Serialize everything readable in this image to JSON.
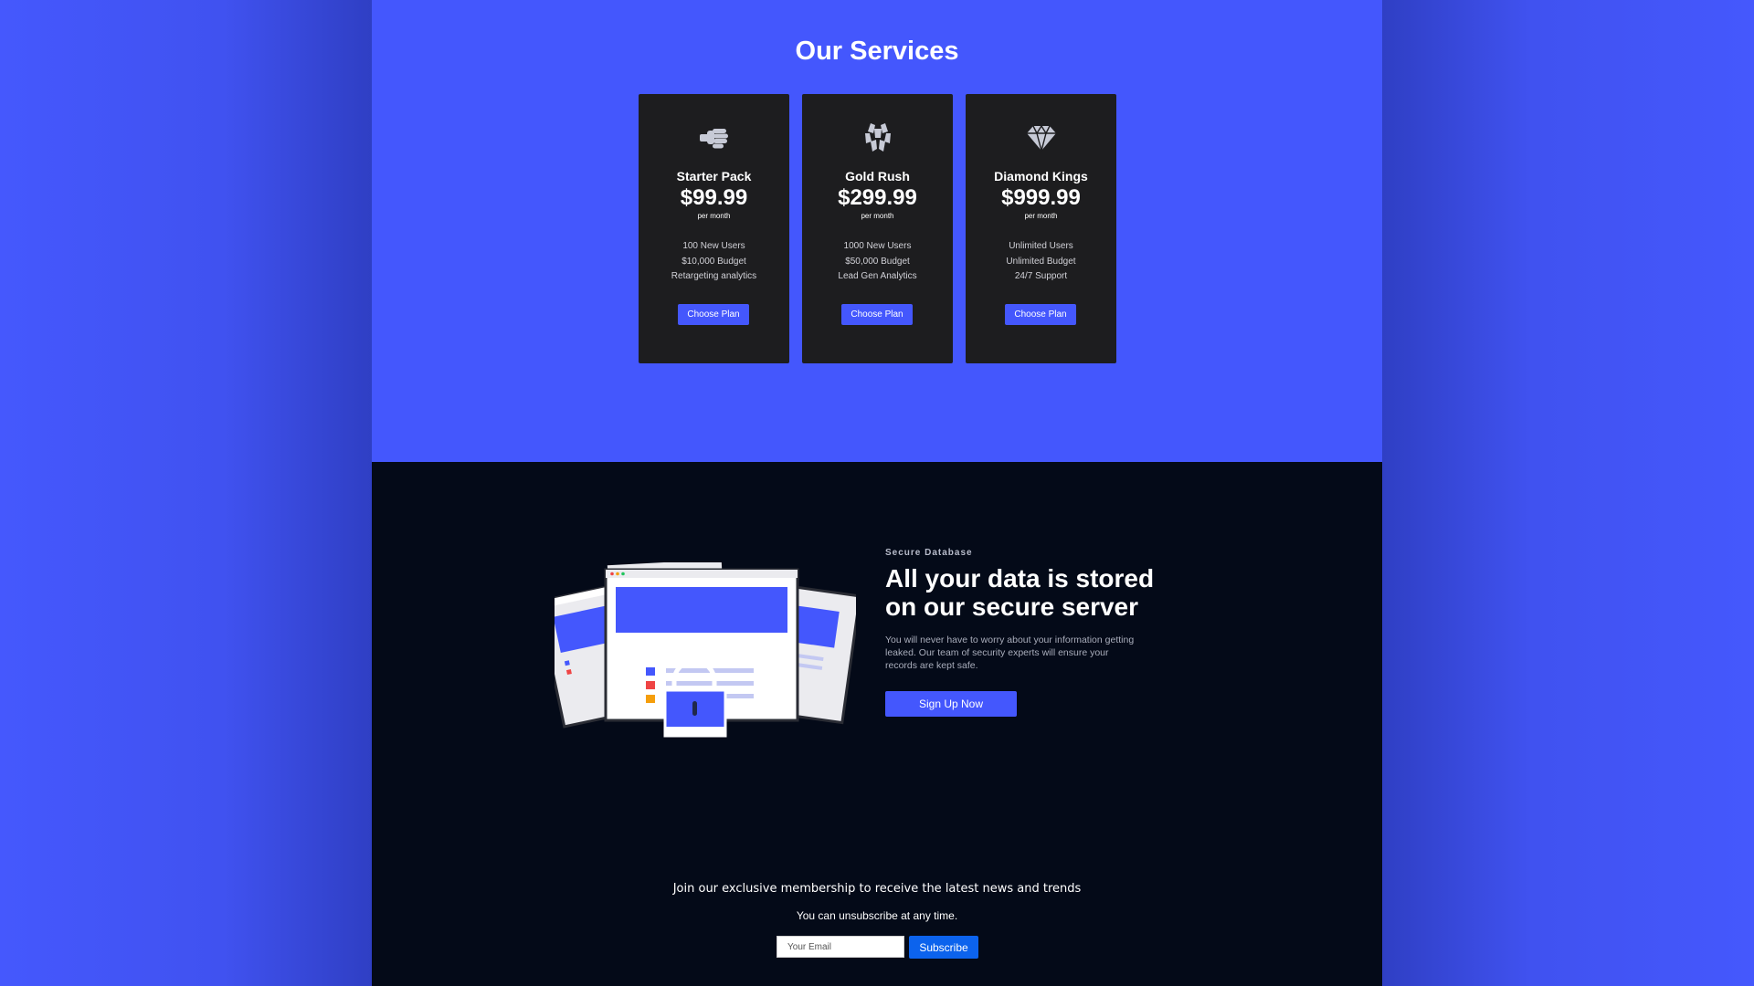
{
  "services": {
    "title": "Our Services",
    "plans": [
      {
        "icon": "fist-bump-icon",
        "name": "Starter Pack",
        "price": "$99.99",
        "period": "per month",
        "features": [
          "100 New Users",
          "$10,000 Budget",
          "Retargeting analytics"
        ],
        "button": "Choose Plan"
      },
      {
        "icon": "gold-bars-icon",
        "name": "Gold Rush",
        "price": "$299.99",
        "period": "per month",
        "features": [
          "1000 New Users",
          "$50,000 Budget",
          "Lead Gen Analytics"
        ],
        "button": "Choose Plan"
      },
      {
        "icon": "diamond-icon",
        "name": "Diamond Kings",
        "price": "$999.99",
        "period": "per month",
        "features": [
          "Unlimited Users",
          "Unlimited Budget",
          "24/7 Support"
        ],
        "button": "Choose Plan"
      }
    ]
  },
  "database": {
    "label": "Secure Database",
    "heading": "All your data is stored on our secure server",
    "text": "You will never have to worry about your information getting leaked. Our team of security experts will ensure your records are kept safe.",
    "button": "Sign Up Now",
    "illustration": "secure-server-illustration"
  },
  "newsletter": {
    "title": "Join our exclusive membership to receive the latest news and trends",
    "subtitle": "You can unsubscribe at any time.",
    "email_placeholder": "Your Email",
    "button": "Subscribe"
  },
  "colors": {
    "primary": "#4457fd",
    "card": "#1d1d1f",
    "dark_bg": "#040a18",
    "subscribe": "#0c63ed"
  }
}
